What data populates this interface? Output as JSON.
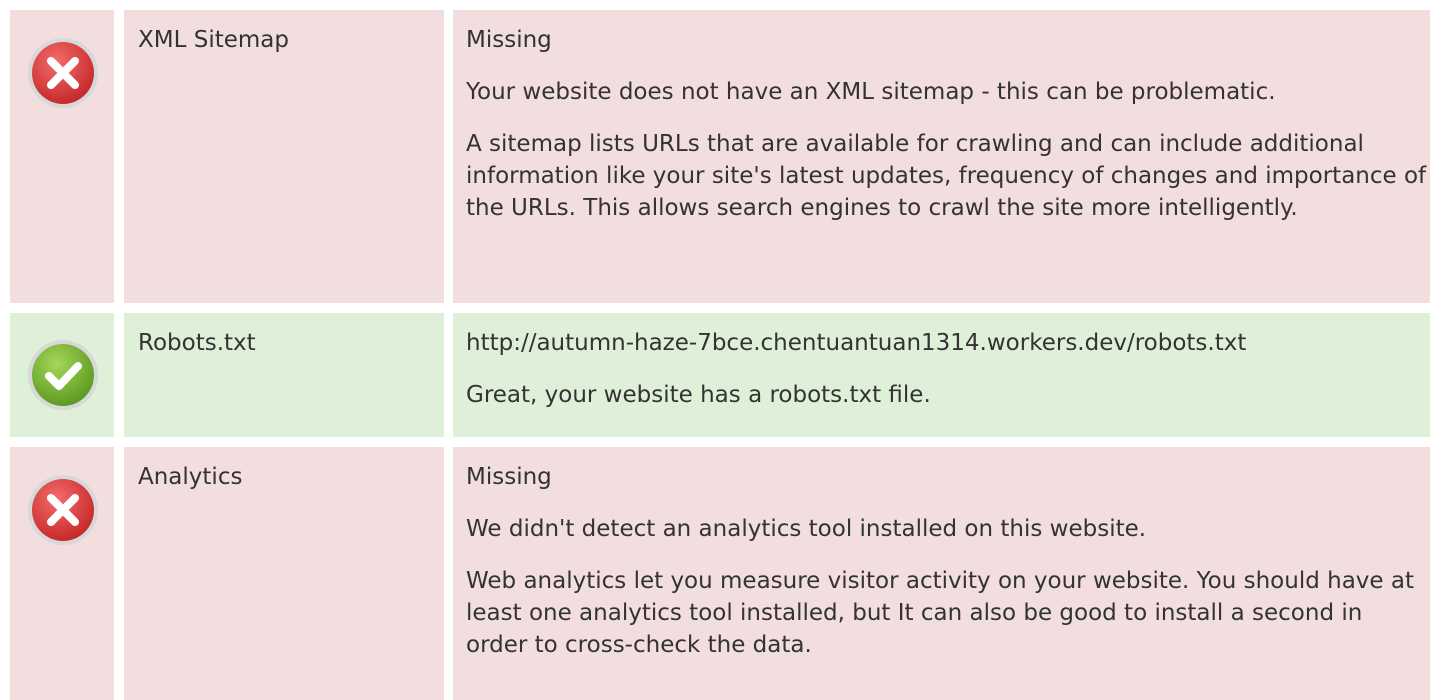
{
  "checks": [
    {
      "status": "fail",
      "status_icon": "error-x-icon",
      "name": "XML Sitemap",
      "value": "Missing",
      "paragraphs": [
        "Your website does not have an XML sitemap - this can be problematic.",
        "A sitemap lists URLs that are available for crawling and can include additional information like your site's latest updates, frequency of changes and importance of the URLs. This allows search engines to crawl the site more intelligently."
      ]
    },
    {
      "status": "pass",
      "status_icon": "success-check-icon",
      "name": "Robots.txt",
      "value": "http://autumn-haze-7bce.chentuantuan1314.workers.dev/robots.txt",
      "paragraphs": [
        "Great, your website has a robots.txt file."
      ]
    },
    {
      "status": "fail",
      "status_icon": "error-x-icon",
      "name": "Analytics",
      "value": "Missing",
      "paragraphs": [
        "We didn't detect an analytics tool installed on this website.",
        "Web analytics let you measure visitor activity on your website. You should have at least one analytics tool installed, but It can also be good to install a second in order to cross-check the data."
      ]
    }
  ],
  "colors": {
    "fail_background": "#f2dede",
    "pass_background": "#dff0d8",
    "fail_icon": "#e53935",
    "pass_icon": "#7cb342",
    "text": "#333333"
  }
}
